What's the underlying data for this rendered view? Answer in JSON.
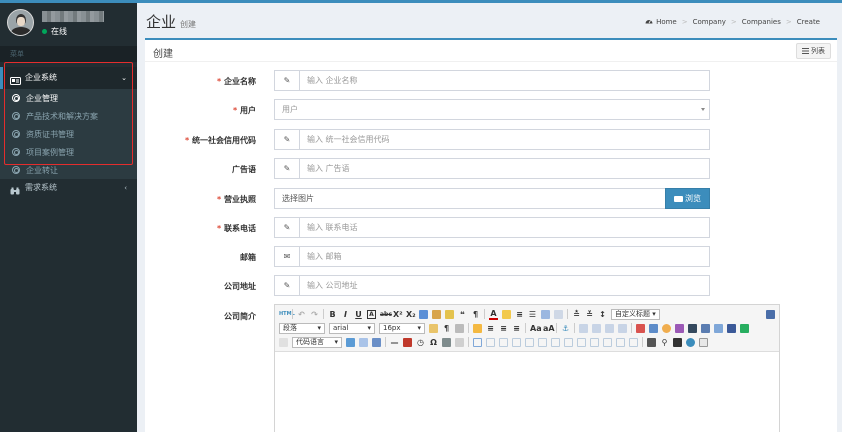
{
  "sidebar": {
    "user_status": "在线",
    "menu_header": "菜单",
    "active_menu": "企业系统",
    "sub_items": [
      "企业管理",
      "产品技术和解决方案",
      "资质证书管理",
      "项目案例管理",
      "企业转让"
    ],
    "second_menu": "需求系统"
  },
  "header": {
    "title": "企业",
    "subtitle": "创建",
    "breadcrumb": [
      "Home",
      "Company",
      "Companies",
      "Create"
    ]
  },
  "box": {
    "title": "创建",
    "list_button": "列表"
  },
  "form": {
    "company_name": {
      "label": "企业名称",
      "required": true,
      "placeholder": "输入 企业名称"
    },
    "user": {
      "label": "用户",
      "required": true,
      "value": "用户"
    },
    "credit_code": {
      "label": "统一社会信用代码",
      "required": true,
      "placeholder": "输入 统一社会信用代码"
    },
    "slogan": {
      "label": "广告语",
      "required": false,
      "placeholder": "输入 广告语"
    },
    "license": {
      "label": "营业执照",
      "required": true,
      "placeholder": "选择图片",
      "browse": "浏览"
    },
    "phone": {
      "label": "联系电话",
      "required": true,
      "placeholder": "输入 联系电话"
    },
    "email": {
      "label": "邮箱",
      "required": false,
      "placeholder": "输入 邮箱"
    },
    "address": {
      "label": "公司地址",
      "required": false,
      "placeholder": "输入 公司地址"
    },
    "intro": {
      "label": "公司简介",
      "required": false
    }
  },
  "editor": {
    "custom_title": "自定义标题",
    "paragraph": "段落",
    "font": "arial",
    "size": "16px",
    "code_lang": "代码语言"
  },
  "colors": {
    "accent": "#3c8dbc",
    "sidebar": "#222d32",
    "required": "#dd4b39",
    "highlight_box": "#e52d2d"
  }
}
